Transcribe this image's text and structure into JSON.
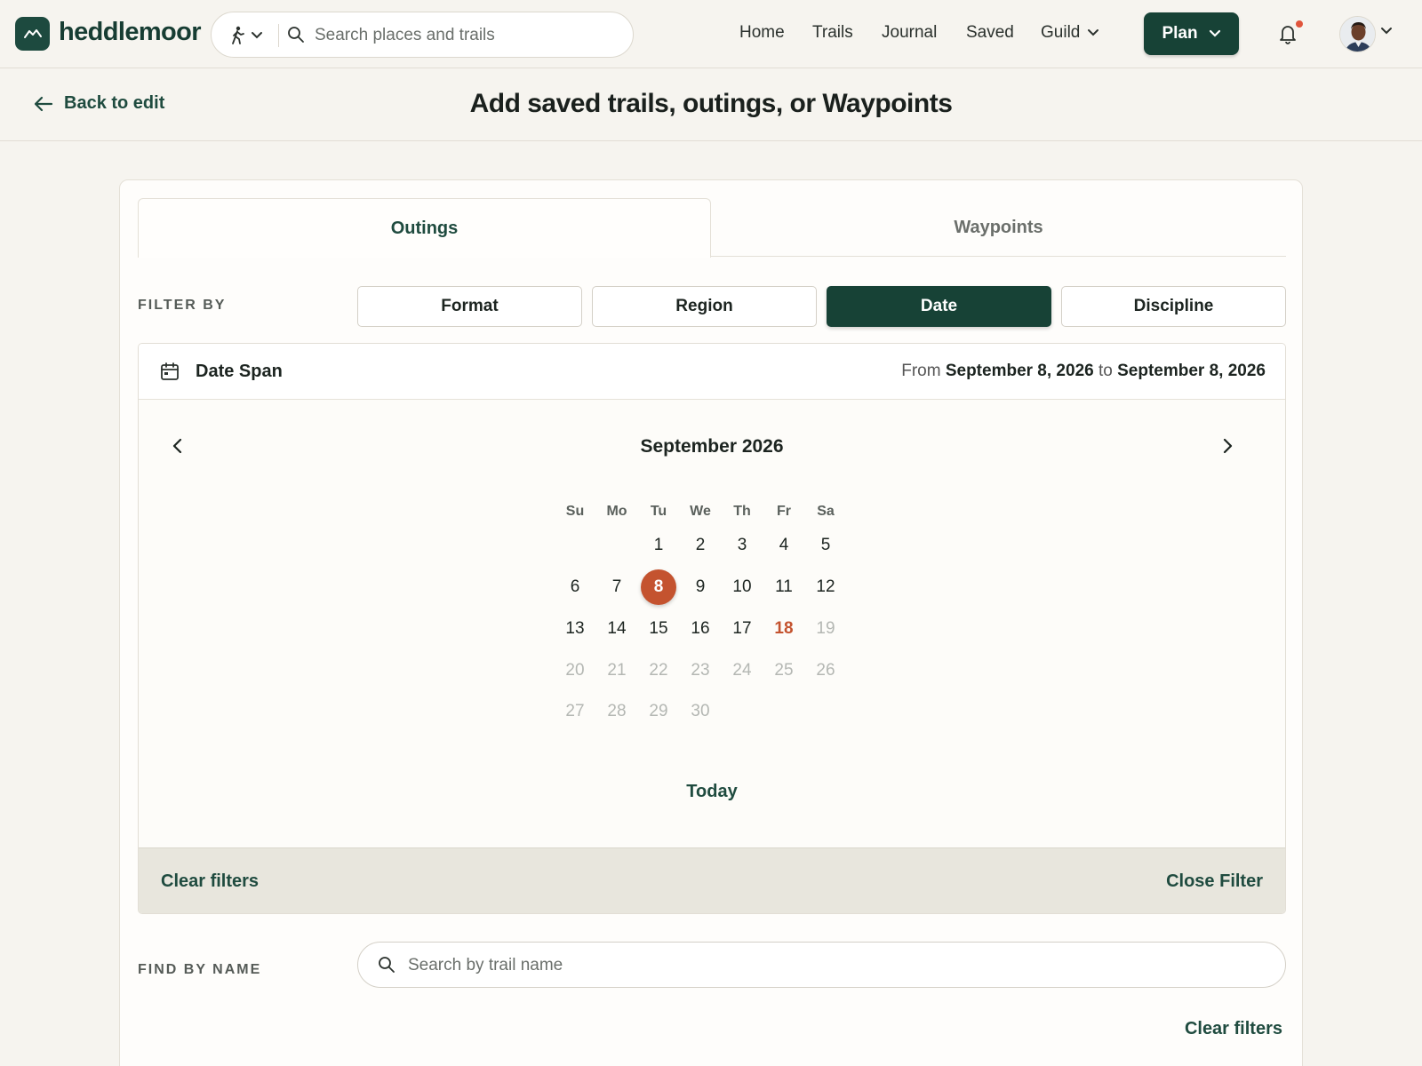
{
  "brand": {
    "name": "heddlemoor"
  },
  "search": {
    "placeholder": "Search places and trails"
  },
  "nav": {
    "home": "Home",
    "trails": "Trails",
    "journal": "Journal",
    "saved": "Saved",
    "guild": "Guild",
    "plan": "Plan"
  },
  "subheader": {
    "back": "Back to edit",
    "title": "Add saved trails, outings, or Waypoints"
  },
  "tabs": {
    "outings": "Outings",
    "waypoints": "Waypoints",
    "active": "Outings"
  },
  "filter": {
    "label": "FILTER BY",
    "chips": [
      "Format",
      "Region",
      "Date",
      "Discipline"
    ],
    "active": "Date"
  },
  "date_span": {
    "label": "Date Span",
    "from_word": "From",
    "from": "September 8, 2026",
    "to_word": "to",
    "to": "September 8, 2026"
  },
  "calendar": {
    "month": "September 2026",
    "weekdays": [
      "Su",
      "Mo",
      "Tu",
      "We",
      "Th",
      "Fr",
      "Sa"
    ],
    "first_weekday": 2,
    "days_in_month": 30,
    "selected": 8,
    "today": 18,
    "disabled_after": 18,
    "today_link": "Today"
  },
  "panel_footer": {
    "clear": "Clear filters",
    "close": "Close Filter"
  },
  "find": {
    "label": "FIND BY NAME",
    "placeholder": "Search by trail name",
    "clear": "Clear filters"
  },
  "colors": {
    "brand": "#174236",
    "accent": "#c4532f",
    "notification": "#e0543b"
  }
}
